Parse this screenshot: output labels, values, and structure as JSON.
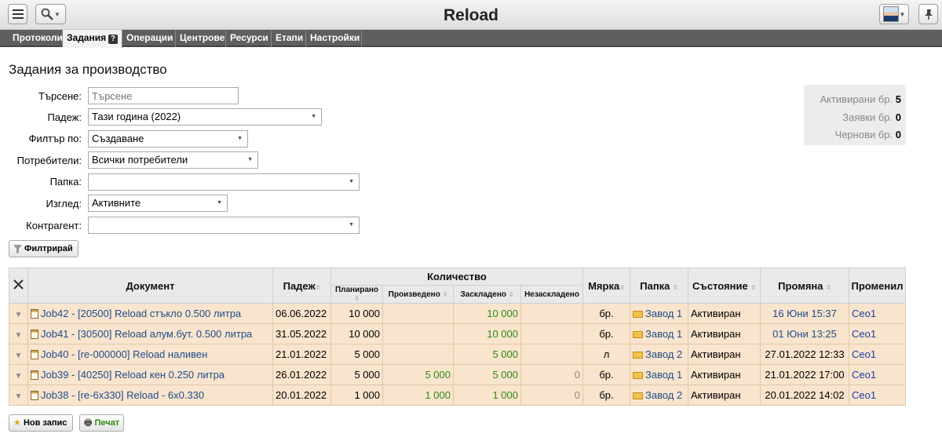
{
  "app": {
    "title": "Reload"
  },
  "tabs": [
    {
      "label": "Протоколи"
    },
    {
      "label": "Задания",
      "active": true,
      "help": "?"
    },
    {
      "label": "Операции"
    },
    {
      "label": "Центрове"
    },
    {
      "label": "Ресурси"
    },
    {
      "label": "Етапи"
    },
    {
      "label": "Настройки"
    }
  ],
  "page": {
    "title": "Задания за производство"
  },
  "filters": {
    "search": {
      "label": "Търсене:",
      "placeholder": "Търсене"
    },
    "deadline": {
      "label": "Падеж:",
      "value": "Тази година (2022)"
    },
    "filter_by": {
      "label": "Филтър по:",
      "value": "Създаване"
    },
    "users": {
      "label": "Потребители:",
      "value": "Всички потребители"
    },
    "folder": {
      "label": "Папка:",
      "value": ""
    },
    "view": {
      "label": "Изглед:",
      "value": "Активните"
    },
    "contractor": {
      "label": "Контрагент:",
      "value": ""
    },
    "button_label": "Филтрирай"
  },
  "stats": [
    {
      "label": "Активирани бр.",
      "value": "5"
    },
    {
      "label": "Заявки бр.",
      "value": "0"
    },
    {
      "label": "Чернови бр.",
      "value": "0"
    }
  ],
  "table": {
    "headers": {
      "document": "Документ",
      "deadline": "Падеж",
      "quantity": "Количество",
      "planned": "Планирано",
      "produced": "Произведено",
      "allocated": "Заскладено",
      "unallocated": "Незаскладено",
      "unit": "Мярка",
      "folder": "Папка",
      "state": "Състояние",
      "modified": "Промяна",
      "modified_by": "Променил"
    },
    "rows": [
      {
        "document": "Job42 - [20500] Reload стъкло 0.500 литра",
        "deadline": "06.06.2022",
        "planned": "10 000",
        "produced": "",
        "allocated": "10 000",
        "unallocated": "",
        "unit": "бр.",
        "folder": "Завод 1",
        "state": "Активиран",
        "modified": "16 Юни 15:37",
        "modified_by": "Ceo1"
      },
      {
        "document": "Job41 - [30500] Reload алум.бут. 0.500 литра",
        "deadline": "31.05.2022",
        "planned": "10 000",
        "produced": "",
        "allocated": "10 000",
        "unallocated": "",
        "unit": "бр.",
        "folder": "Завод 1",
        "state": "Активиран",
        "modified": "01 Юни 13:25",
        "modified_by": "Ceo1"
      },
      {
        "document": "Job40 - [re-000000] Reload наливен",
        "deadline": "21.01.2022",
        "planned": "5 000",
        "produced": "",
        "allocated": "5 000",
        "unallocated": "",
        "unit": "л",
        "folder": "Завод 2",
        "state": "Активиран",
        "modified": "27.01.2022 12:33",
        "modified_by": "Ceo1"
      },
      {
        "document": "Job39 - [40250] Reload кен 0.250 литра",
        "deadline": "26.01.2022",
        "planned": "5 000",
        "produced": "5 000",
        "allocated": "5 000",
        "unallocated": "0",
        "unit": "бр.",
        "folder": "Завод 1",
        "state": "Активиран",
        "modified": "21.01.2022 17:00",
        "modified_by": "Ceo1"
      },
      {
        "document": "Job38 - [re-6x330] Reload - 6x0.330",
        "deadline": "20.01.2022",
        "planned": "1 000",
        "produced": "1 000",
        "allocated": "1 000",
        "unallocated": "0",
        "unit": "бр.",
        "folder": "Завод 2",
        "state": "Активиран",
        "modified": "20.01.2022 14:02",
        "modified_by": "Ceo1"
      }
    ]
  },
  "actions": {
    "new_record": "Нов запис",
    "print": "Печат"
  }
}
